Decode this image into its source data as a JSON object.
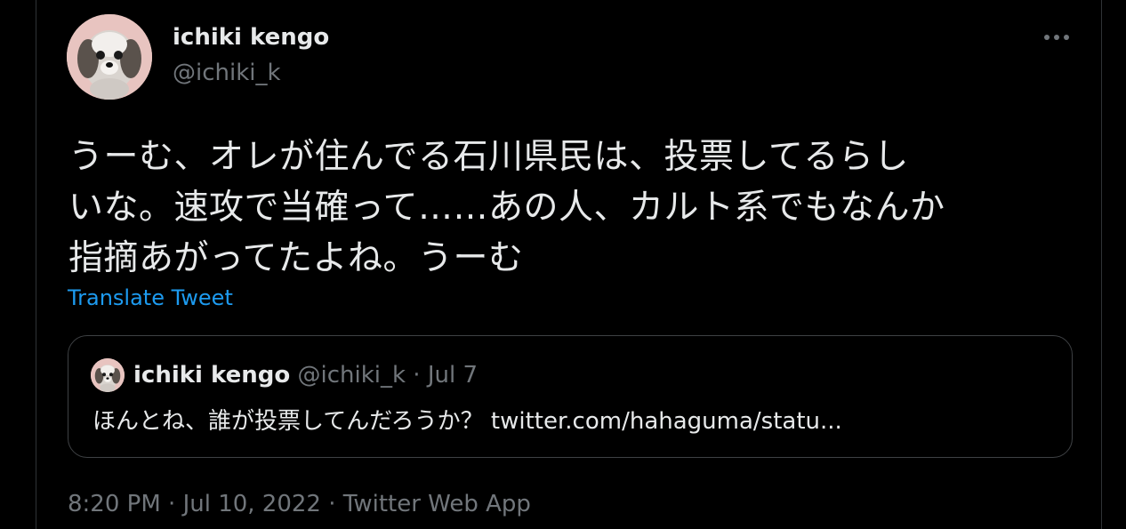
{
  "tweet": {
    "author": {
      "display_name": "ichiki kengo",
      "handle": "@ichiki_k"
    },
    "text_lines": [
      "うーむ、オレが住んでる石川県民は、投票してるらし",
      "いな。速攻で当確って……あの人、カルト系でもなんか",
      "指摘あがってたよね。うーむ"
    ],
    "translate_label": "Translate Tweet",
    "quoted": {
      "display_name": "ichiki kengo",
      "handle": "@ichiki_k",
      "separator": " · ",
      "date": "Jul 7",
      "text": "ほんとね、誰が投票してんだろうか？ twitter.com/hahaguma/statu..."
    },
    "meta": {
      "time": "8:20 PM",
      "separator": " · ",
      "date": "Jul 10, 2022",
      "source": "Twitter Web App"
    },
    "colors": {
      "background": "#000000",
      "text": "#e7e9ea",
      "secondary": "#71767b",
      "link": "#1d9bf0",
      "border": "#2f3336"
    },
    "icons": {
      "more": "more-horizontal-icon"
    }
  }
}
